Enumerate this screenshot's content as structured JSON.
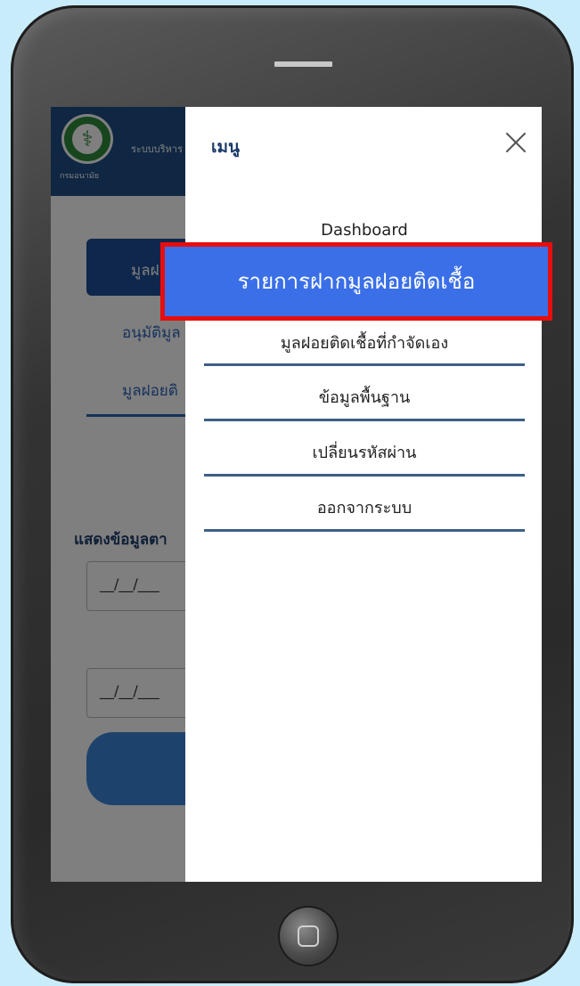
{
  "background_app": {
    "org_name": "กรมอนามัย",
    "header_title": "ระบบบริหาร",
    "nav_active_label": "มูลฝอ",
    "nav_links": [
      "อนุมัติมูล",
      "มูลฝอยติ"
    ],
    "filter_label": "แสดงข้อมูลตา",
    "date_placeholder_1": "__/__/___",
    "date_placeholder_2": "__/__/___"
  },
  "drawer": {
    "title": "เมนู",
    "close_icon": "close-icon",
    "items": [
      {
        "label": "Dashboard"
      },
      {
        "label": "รายการฝากมูลฝอยติดเชื้อ",
        "highlighted": true
      },
      {
        "label": "มูลฝอยติดเชื้อที่กำจัดเอง"
      },
      {
        "label": "ข้อมูลพื้นฐาน"
      },
      {
        "label": "เปลี่ยนรหัสผ่าน"
      },
      {
        "label": "ออกจากระบบ"
      }
    ]
  },
  "colors": {
    "highlight_fill": "#3a6fe8",
    "highlight_border": "#e80d0d",
    "divider": "#3e5f85"
  }
}
